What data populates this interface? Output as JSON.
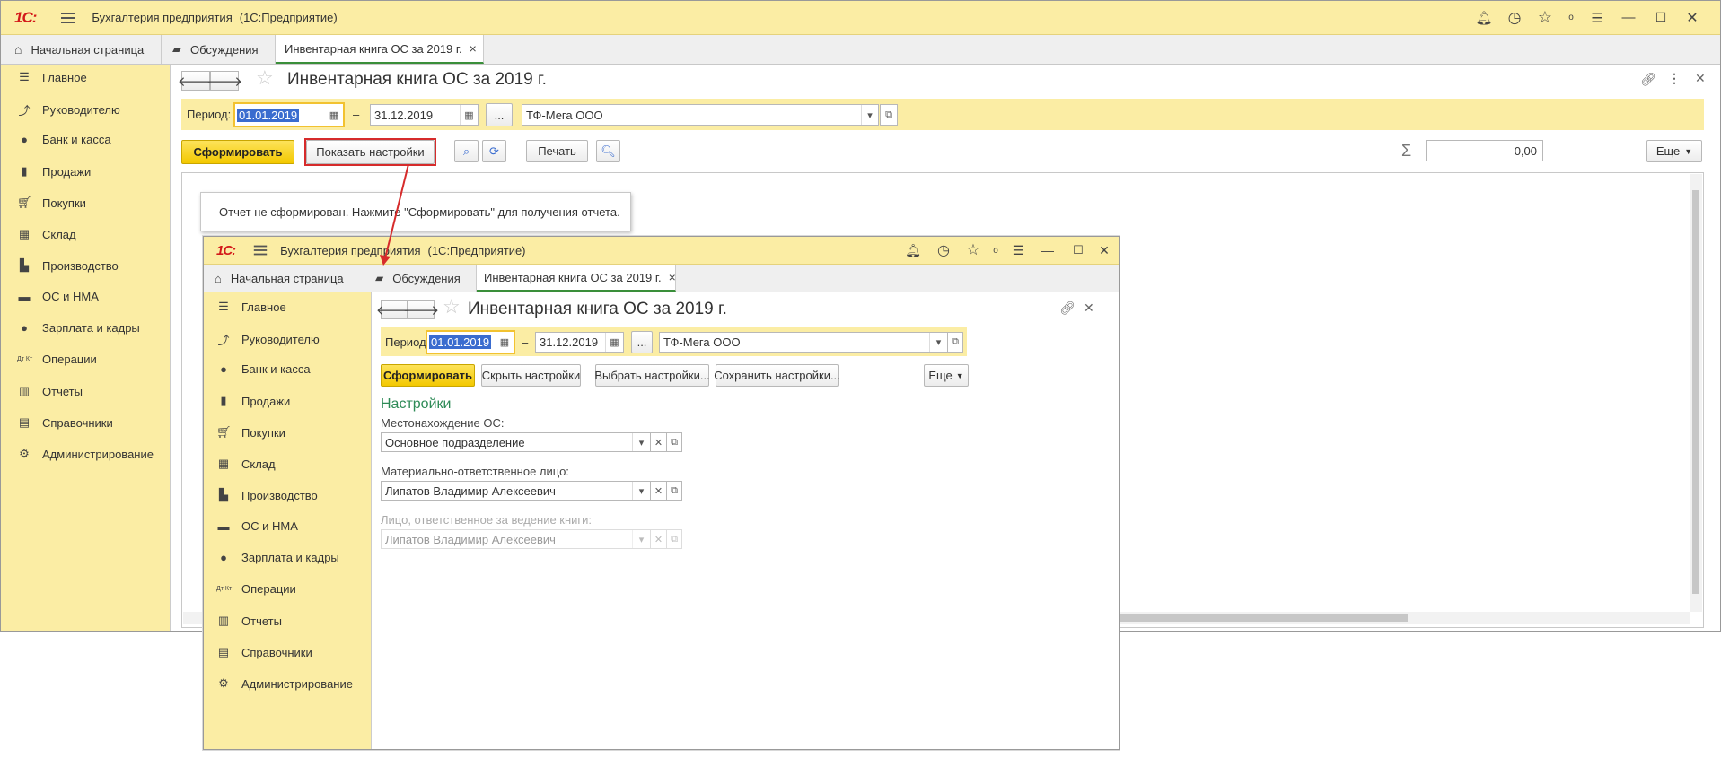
{
  "app": {
    "logo": "1С:",
    "title": "Бухгалтерия предприятия",
    "platform": "(1С:Предприятие)"
  },
  "tabs": {
    "home": "Начальная страница",
    "discussions": "Обсуждения",
    "report": "Инвентарная книга ОС за 2019 г.",
    "close": "×"
  },
  "sidebar": [
    {
      "label": "Главное",
      "icon": "menu-lines-icon"
    },
    {
      "label": "Руководителю",
      "icon": "trend-icon"
    },
    {
      "label": "Банк и касса",
      "icon": "coin-icon"
    },
    {
      "label": "Продажи",
      "icon": "bag-icon"
    },
    {
      "label": "Покупки",
      "icon": "cart-icon"
    },
    {
      "label": "Склад",
      "icon": "grid-icon"
    },
    {
      "label": "Производство",
      "icon": "factory-icon"
    },
    {
      "label": "ОС и НМА",
      "icon": "truck-icon"
    },
    {
      "label": "Зарплата и кадры",
      "icon": "person-icon"
    },
    {
      "label": "Операции",
      "icon": "dt-kt-icon"
    },
    {
      "label": "Отчеты",
      "icon": "bar-chart-icon"
    },
    {
      "label": "Справочники",
      "icon": "books-icon"
    },
    {
      "label": "Администрирование",
      "icon": "gear-icon"
    }
  ],
  "icons": {
    "dtkt": "Дт Кт"
  },
  "report": {
    "title": "Инвентарная книга ОС за 2019 г.",
    "period_label": "Период:",
    "date_from": "01.01.2019",
    "dash": "–",
    "date_to": "31.12.2019",
    "ellipsis": "...",
    "organization": "ТФ-Мега ООО",
    "generate": "Сформировать",
    "show_settings": "Показать настройки",
    "hide_settings": "Скрыть настройки",
    "choose_settings": "Выбрать настройки...",
    "save_settings": "Сохранить настройки...",
    "print": "Печать",
    "more": "Еще",
    "sum_symbol": "Σ",
    "sum_value": "0,00",
    "not_generated_msg": "Отчет не сформирован. Нажмите \"Сформировать\" для получения отчета."
  },
  "settings": {
    "group_title": "Настройки",
    "location_label": "Местонахождение ОС:",
    "location_value": "Основное подразделение",
    "mol_label": "Материально-ответственное лицо:",
    "mol_value": "Липатов Владимир Алексеевич",
    "book_label": "Лицо, ответственное за ведение книги:",
    "book_value": "Липатов Владимир Алексеевич"
  },
  "colors": {
    "panel_yellow": "#fbeda4",
    "primary_button": "#f3c800",
    "highlight_red": "#d62b2b",
    "settings_green": "#2e8b57",
    "selection_blue": "#3a6ccf"
  }
}
